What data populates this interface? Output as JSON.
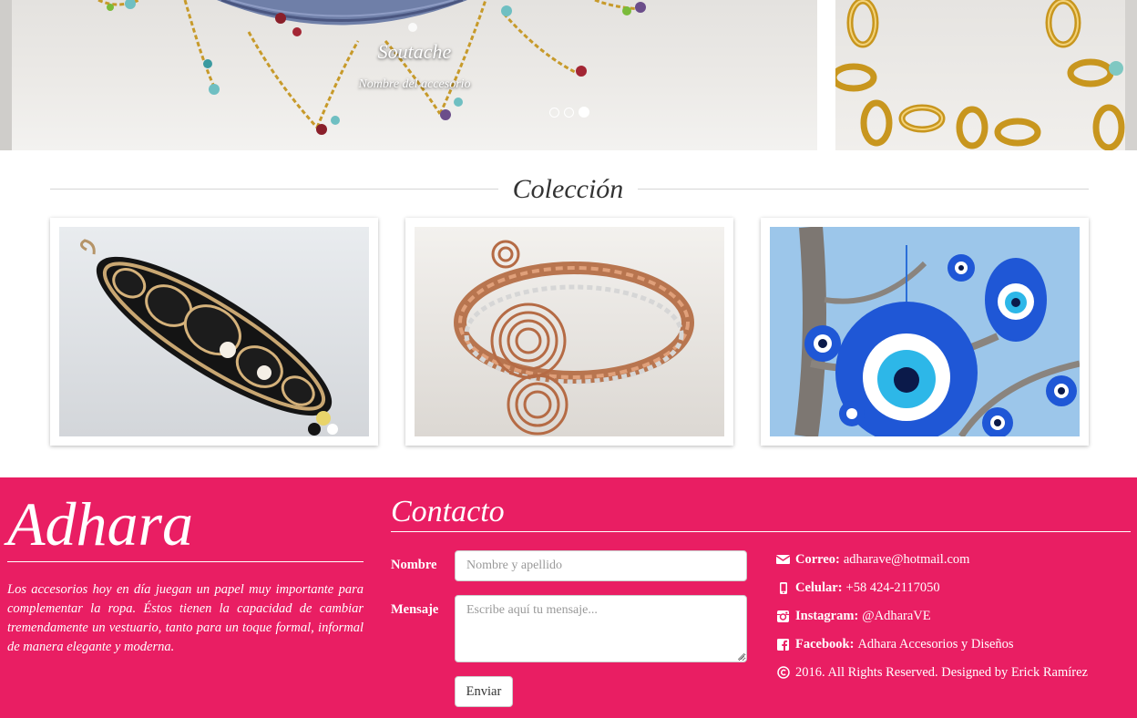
{
  "carousel": {
    "caption_title": "Soutache",
    "caption_subtitle": "Nombre del accesorio",
    "indicator_count": 3,
    "active_indicator": 3
  },
  "collection": {
    "title": "Colección"
  },
  "footer": {
    "brand": "Adhara",
    "about": "Los accesorios hoy en día juegan un papel muy importante para complementar la ropa. Éstos tienen la capacidad de cambiar tremendamente un vestuario, tanto para un toque formal, informal de manera elegante y moderna.",
    "contact_title": "Contacto",
    "form": {
      "name_label": "Nombre",
      "name_placeholder": "Nombre y apellido",
      "message_label": "Mensaje",
      "message_placeholder": "Escribe aquí tu mensaje...",
      "submit_label": "Enviar"
    },
    "info": {
      "email_label": "Correo:",
      "email_value": "adharave@hotmail.com",
      "phone_label": "Celular:",
      "phone_value": "+58 424-2117050",
      "instagram_label": "Instagram:",
      "instagram_value": "@AdharaVE",
      "facebook_label": "Facebook:",
      "facebook_value": "Adhara Accesorios y Diseños",
      "copyright": "2016. All Rights Reserved. Designed by Erick Ramírez"
    }
  },
  "colors": {
    "footer_bg": "#e91e63",
    "text_dark": "#333333",
    "white": "#ffffff"
  },
  "icons": [
    "envelope-icon",
    "mobile-phone-icon",
    "instagram-icon",
    "facebook-icon",
    "copyright-icon"
  ]
}
